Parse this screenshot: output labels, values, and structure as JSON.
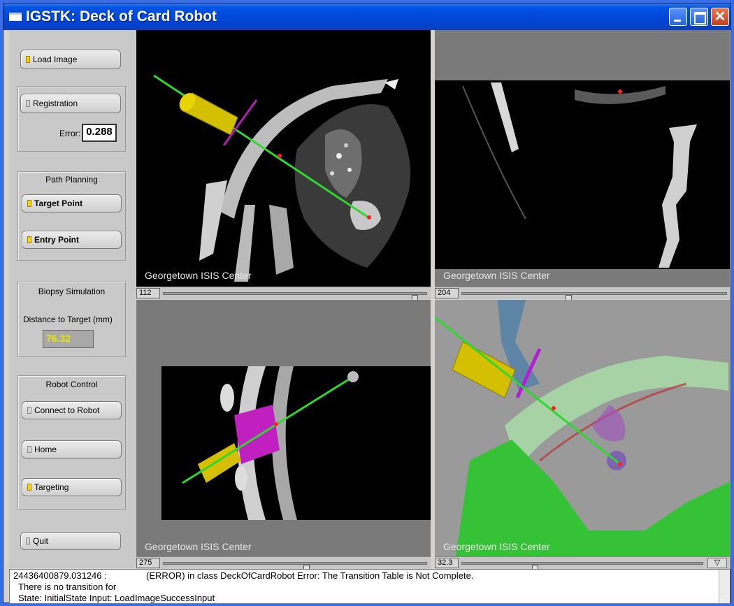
{
  "window": {
    "title": "IGSTK: Deck of Card Robot"
  },
  "controls": {
    "load_image": "Load Image",
    "registration": "Registration",
    "error_label": "Error:",
    "error_value": "0.288",
    "path_planning_title": "Path Planning",
    "target_point": "Target Point",
    "entry_point": "Entry Point",
    "biopsy_title": "Biopsy Simulation",
    "distance_label": "Distance to Target (mm)",
    "distance_value": "76.32",
    "robot_control_title": "Robot Control",
    "connect_robot": "Connect to Robot",
    "home": "Home",
    "targeting": "Targeting",
    "quit": "Quit"
  },
  "views": [
    {
      "caption": "Georgetown ISIS Center",
      "slider_value": "112",
      "slider_level": 0.95
    },
    {
      "caption": "Georgetown ISIS Center",
      "slider_value": "204",
      "slider_level": 0.44
    },
    {
      "caption": "Georgetown ISIS Center",
      "slider_value": "275",
      "slider_level": 0.55
    },
    {
      "caption": "Georgetown ISIS Center",
      "slider_value": "32.3",
      "slider_level": 0.3
    }
  ],
  "log": {
    "line1_a": "24436400879.031246  :",
    "line1_b": "(ERROR) in class DeckOfCardRobot Error: The Transition Table is Not Complete.",
    "line2": "There is no transition for",
    "line3": "State: InitialState Input: LoadImageSuccessInput"
  },
  "colors": {
    "titlebar": "#0054e3",
    "panel": "#c9c9c9",
    "needle": "#2ed82e",
    "holder": "#d4c000",
    "guide": "#c020c0"
  }
}
